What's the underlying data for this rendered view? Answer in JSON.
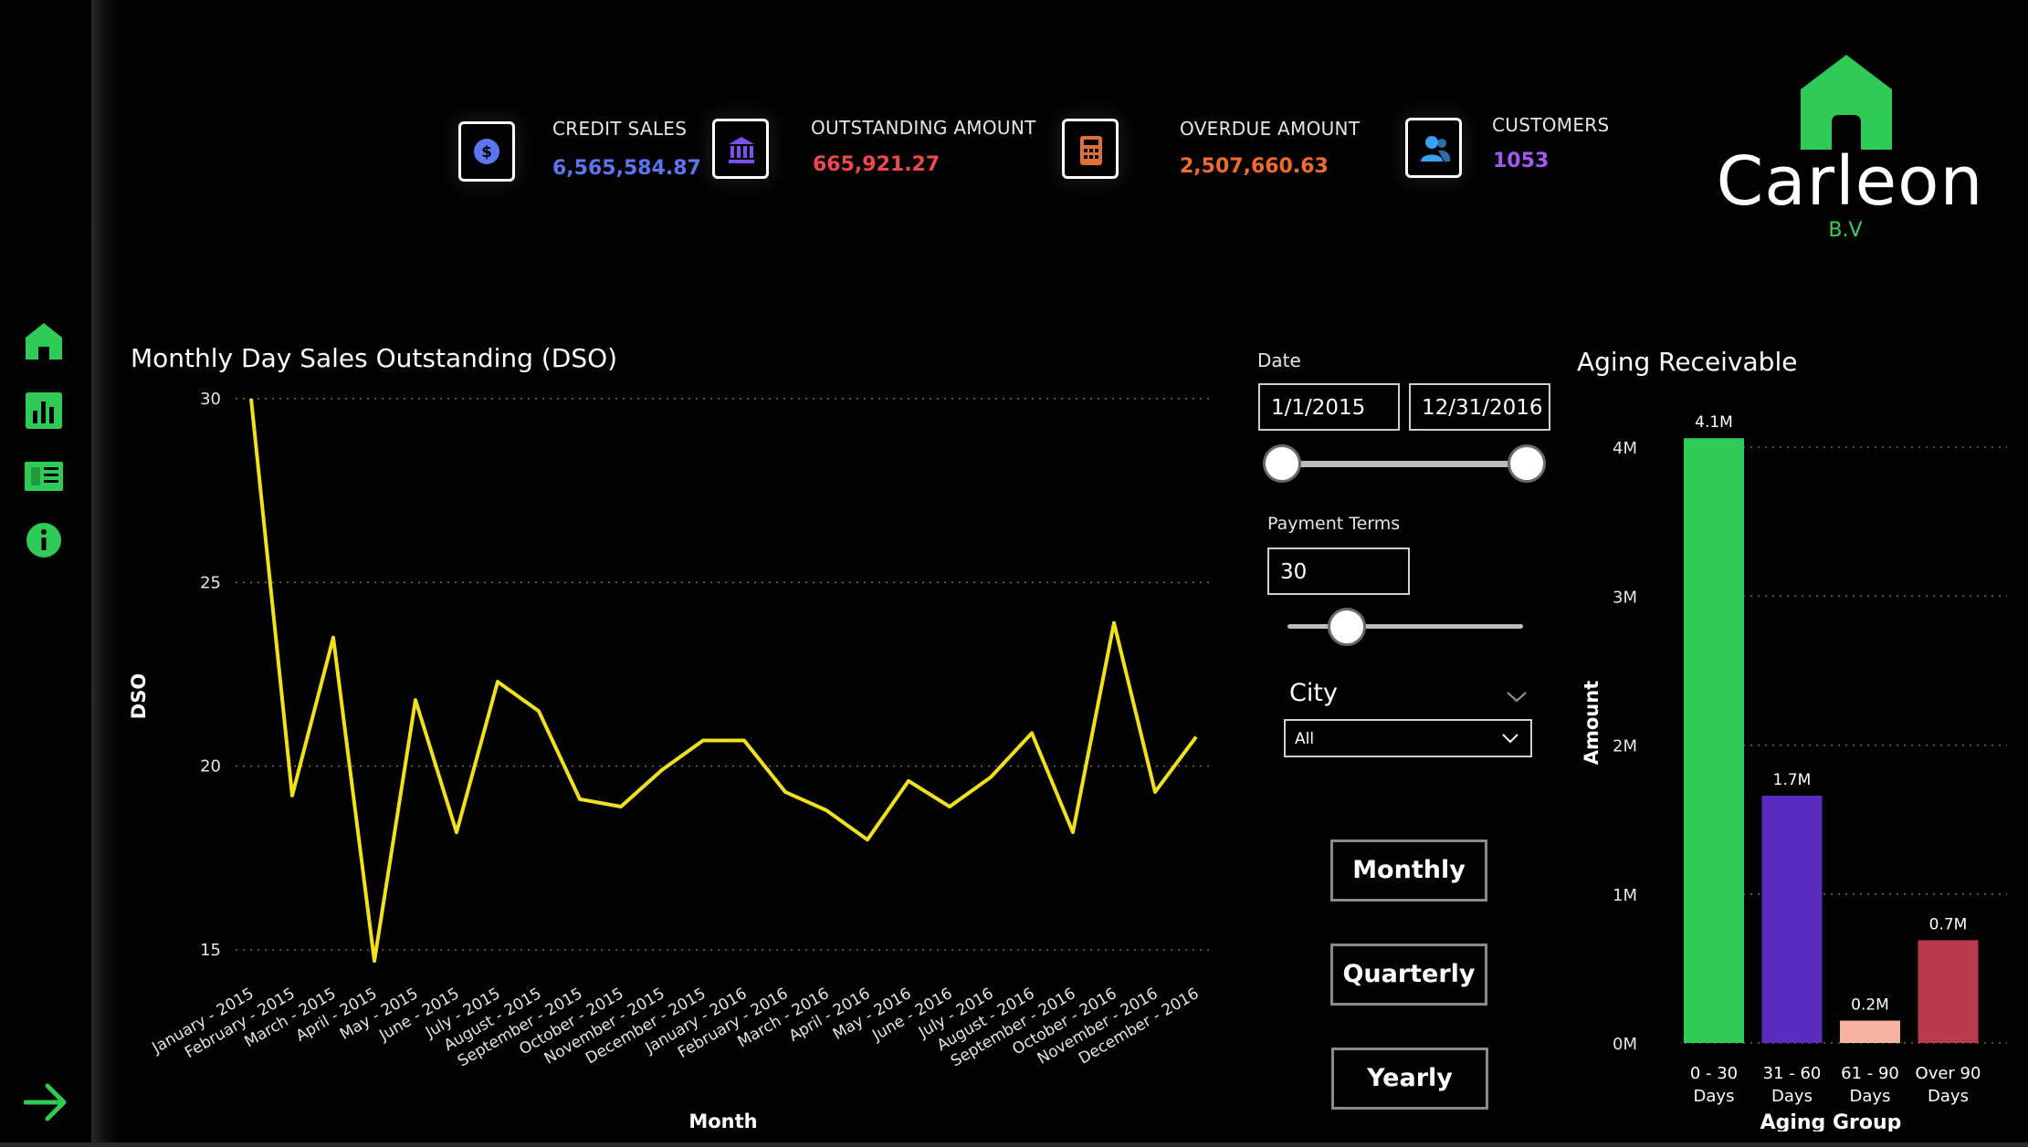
{
  "kpis": [
    {
      "label": "CREDIT SALES",
      "value": "6,565,584.87",
      "color": "#5b76f0",
      "icon": "dollar-coin-icon"
    },
    {
      "label": "OUTSTANDING AMOUNT",
      "value": "665,921.27",
      "color": "#f0474f",
      "icon": "bank-icon"
    },
    {
      "label": "OVERDUE AMOUNT",
      "value": "2,507,660.63",
      "color": "#f26a2e",
      "icon": "calculator-icon"
    },
    {
      "label": "CUSTOMERS",
      "value": "1053",
      "color": "#a259f5",
      "icon": "users-icon"
    }
  ],
  "logo": {
    "name": "Carleon",
    "sub": "B.V",
    "color": "#2ecc56"
  },
  "nav": [
    {
      "icon": "home-icon"
    },
    {
      "icon": "bar-chart-icon"
    },
    {
      "icon": "report-icon"
    },
    {
      "icon": "info-icon"
    }
  ],
  "filters": {
    "date_label": "Date",
    "date_start": "1/1/2015",
    "date_end": "12/31/2016",
    "payment_terms_label": "Payment Terms",
    "payment_terms_value": "30",
    "payment_terms_slider_fraction": 0.25,
    "city_label": "City",
    "city_value": "All"
  },
  "buttons": {
    "monthly": "Monthly",
    "quarterly": "Quarterly",
    "yearly": "Yearly"
  },
  "chart_data": [
    {
      "type": "line",
      "title": "Monthly Day Sales Outstanding (DSO)",
      "xlabel": "Month",
      "ylabel": "DSO",
      "ylim": [
        15,
        30
      ],
      "yticks": [
        15,
        20,
        25,
        30
      ],
      "grid": true,
      "color": "#f2e11a",
      "categories": [
        "January - 2015",
        "February - 2015",
        "March - 2015",
        "April - 2015",
        "May - 2015",
        "June - 2015",
        "July - 2015",
        "August - 2015",
        "September - 2015",
        "October - 2015",
        "November - 2015",
        "December - 2015",
        "January - 2016",
        "February - 2016",
        "March - 2016",
        "April - 2016",
        "May - 2016",
        "June - 2016",
        "July - 2016",
        "August - 2016",
        "September - 2016",
        "October - 2016",
        "November - 2016",
        "December - 2016"
      ],
      "values": [
        30.0,
        19.2,
        23.5,
        14.7,
        21.8,
        18.2,
        22.3,
        21.5,
        19.1,
        18.9,
        19.9,
        20.7,
        20.7,
        19.3,
        18.8,
        18.0,
        19.6,
        18.9,
        19.7,
        20.9,
        18.2,
        23.9,
        19.3,
        20.8
      ]
    },
    {
      "type": "bar",
      "title": "Aging Receivable",
      "xlabel": "Aging Group",
      "ylabel": "Amount",
      "ylim": [
        0,
        4000000
      ],
      "yticks": [
        "0M",
        "1M",
        "2M",
        "3M",
        "4M"
      ],
      "grid": true,
      "categories": [
        "0 - 30 Days",
        "31 - 60 Days",
        "61 - 90 Days",
        "Over 90 Days"
      ],
      "values": [
        4060000,
        1660000,
        150000,
        690000
      ],
      "data_labels": [
        "4.1M",
        "1.7M",
        "0.2M",
        "0.7M"
      ],
      "colors": [
        "#2ecc56",
        "#5b2bc0",
        "#f7b3a0",
        "#b83a4b"
      ]
    }
  ]
}
